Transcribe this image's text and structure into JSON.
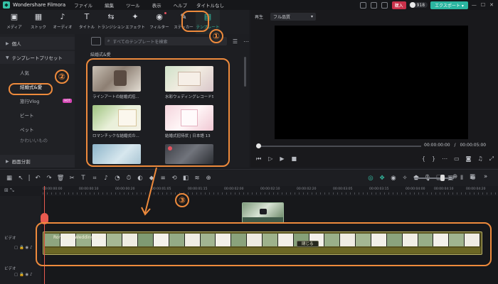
{
  "app": {
    "name": "Wondershare Filmora",
    "document_title": "タイトルなし",
    "menu": [
      "ファイル",
      "編集",
      "ツール",
      "表示",
      "ヘルプ"
    ],
    "buy_label": "購入",
    "credits": "918",
    "export_label": "エクスポート ▾"
  },
  "asset_tabs": [
    {
      "icon": "▣",
      "label": "メディア",
      "name": "tab-media"
    },
    {
      "icon": "▦",
      "label": "ストック",
      "name": "tab-stock"
    },
    {
      "icon": "♪",
      "label": "オーディオ",
      "name": "tab-audio"
    },
    {
      "icon": "T",
      "label": "タイトル",
      "name": "tab-title"
    },
    {
      "icon": "⇆",
      "label": "トランジション",
      "name": "tab-transition"
    },
    {
      "icon": "✦",
      "label": "エフェクト",
      "name": "tab-effect"
    },
    {
      "icon": "◉",
      "label": "フィルター",
      "name": "tab-filter"
    },
    {
      "icon": "✎",
      "label": "ステッカー",
      "name": "tab-sticker"
    },
    {
      "icon": "▤",
      "label": "テンプレート",
      "name": "tab-template"
    }
  ],
  "categories": {
    "personal": "個人",
    "presets": "テンプレートプリセット",
    "items": [
      "人気",
      "結婚式&愛",
      "旅行Vlog",
      "ビート",
      "ペット",
      "かわいいもの"
    ],
    "selected_index": 1,
    "hot_badge": "HOT",
    "split_screen": "画面分割"
  },
  "browser": {
    "search_placeholder": "すべてのテンプレートを検索",
    "section_label": "結婚式&愛",
    "cards": [
      {
        "name": "ラインアートの結婚式招..."
      },
      {
        "name": "水彩ウェディングレコードS1"
      },
      {
        "name": "ロマンチックな結婚式の..."
      },
      {
        "name": "結婚式招待状 | 日本語 13"
      },
      {
        "name": ""
      },
      {
        "name": ""
      }
    ]
  },
  "preview": {
    "label": "再生",
    "quality": "フル品質",
    "current_time": "00:00:00:00",
    "separator": "/",
    "total_time": "00:00:05:00"
  },
  "timeline": {
    "ruler_ticks": [
      "00:00:00:00",
      "00:00:00:10",
      "00:00:00:20",
      "00:00:01:05",
      "00:00:01:15",
      "00:00:02:00",
      "00:00:02:10",
      "00:00:02:20",
      "00:00:03:05",
      "00:00:03:15",
      "00:00:04:00",
      "00:00:04:10",
      "00:00:04:20"
    ],
    "track_video": "ビデオ",
    "track_video2": "ビデオ",
    "clip_title": "Romantic Wedding Intro",
    "close_label": "閉じる"
  },
  "annotations": [
    "①",
    "②",
    "③"
  ],
  "colors": {
    "accent": "#35c2a6",
    "annotation": "#ee8a3c",
    "playhead": "#e85a4f"
  }
}
